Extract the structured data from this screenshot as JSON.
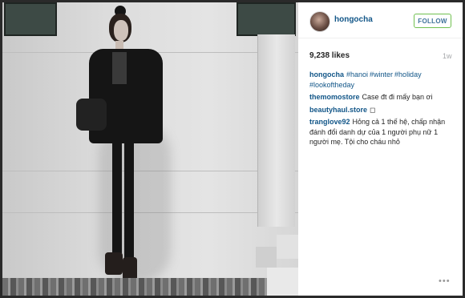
{
  "post": {
    "username": "hongocha",
    "follow_label": "FOLLOW",
    "likes": "9,238 likes",
    "age": "1w",
    "caption": {
      "username": "hongocha",
      "tags": [
        "#hanoi",
        "#winter",
        "#holiday",
        "#lookoftheday"
      ]
    },
    "comments": [
      {
        "username": "themomostore",
        "text": "Case đt đi mấy bạn ơi"
      },
      {
        "username": "beautyhaul.store",
        "text": "◻"
      },
      {
        "username": "tranglove92",
        "text": "Hỏng cả 1 thế hệ, chấp nhận đánh đổi danh dự của 1 người phụ nữ 1 người mẹ. Tội cho cháu nhỏ"
      }
    ],
    "more_icon": "ellipsis-icon"
  },
  "colors": {
    "link": "#125688",
    "follow_border": "#70c050",
    "follow_text": "#3f729b",
    "muted": "#a5a7aa"
  }
}
